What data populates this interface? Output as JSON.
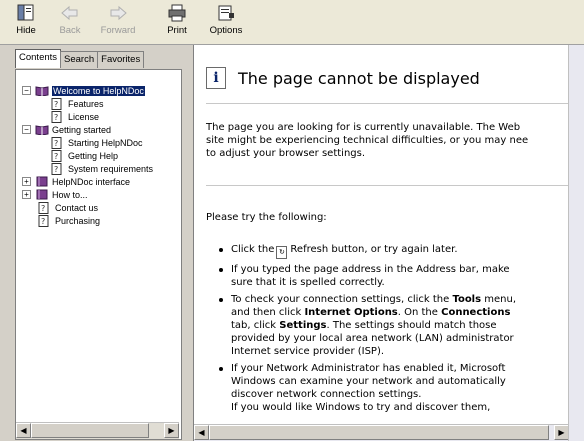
{
  "toolbar": {
    "buttons": [
      {
        "label": "Hide",
        "icon": "hide-icon"
      },
      {
        "label": "Back",
        "icon": "back-arrow-icon"
      },
      {
        "label": "Forward",
        "icon": "forward-arrow-icon"
      },
      {
        "label": "Print",
        "icon": "printer-icon"
      },
      {
        "label": "Options",
        "icon": "options-icon"
      }
    ]
  },
  "nav": {
    "tabs": [
      "Contents",
      "Search",
      "Favorites"
    ],
    "tree": [
      {
        "label": "Welcome to HelpNDoc",
        "icon": "book-open-icon",
        "expander": "−",
        "selected": true
      },
      {
        "label": "Features",
        "icon": "help-page-icon"
      },
      {
        "label": "License",
        "icon": "help-page-icon"
      },
      {
        "label": "Getting started",
        "icon": "book-open-icon",
        "expander": "−"
      },
      {
        "label": "Starting HelpNDoc",
        "icon": "help-page-icon"
      },
      {
        "label": "Getting Help",
        "icon": "help-page-icon"
      },
      {
        "label": "System requirements",
        "icon": "help-page-icon"
      },
      {
        "label": "HelpNDoc interface",
        "icon": "book-closed-icon",
        "expander": "+"
      },
      {
        "label": "How to...",
        "icon": "book-closed-icon",
        "expander": "+"
      },
      {
        "label": "Contact us",
        "icon": "help-page-icon"
      },
      {
        "label": "Purchasing",
        "icon": "help-page-icon"
      }
    ]
  },
  "content": {
    "title": "The page cannot be displayed",
    "intro": [
      "The page you are looking for is currently unavailable. The Web",
      "site might be experiencing technical difficulties, or you may nee",
      "to adjust your browser settings."
    ],
    "try_heading": "Please try the following:",
    "bullets": {
      "b1_before": "Click the",
      "b1_after": "Refresh button, or try again later.",
      "b2_line1": "If you typed the page address in the Address bar, make",
      "b2_line2": "sure that it is spelled correctly.",
      "b3_l1_a": "To check your connection settings, click the ",
      "b3_l1_b": "Tools",
      "b3_l1_c": " menu,",
      "b3_l2_a": "and then click ",
      "b3_l2_b": "Internet Options",
      "b3_l2_c": ". On the ",
      "b3_l2_d": "Connections",
      "b3_l3_a": "tab, click ",
      "b3_l3_b": "Settings",
      "b3_l3_c": ". The settings should match those",
      "b3_l4": "provided by your local area network (LAN) administrator",
      "b3_l5": "Internet service provider (ISP).",
      "b4_l1": "If your Network Administrator has enabled it, Microsoft",
      "b4_l2": "Windows can examine your network and automatically",
      "b4_l3": "discover network connection settings.",
      "b4_l4": "If you would like Windows to try and discover them,"
    }
  }
}
